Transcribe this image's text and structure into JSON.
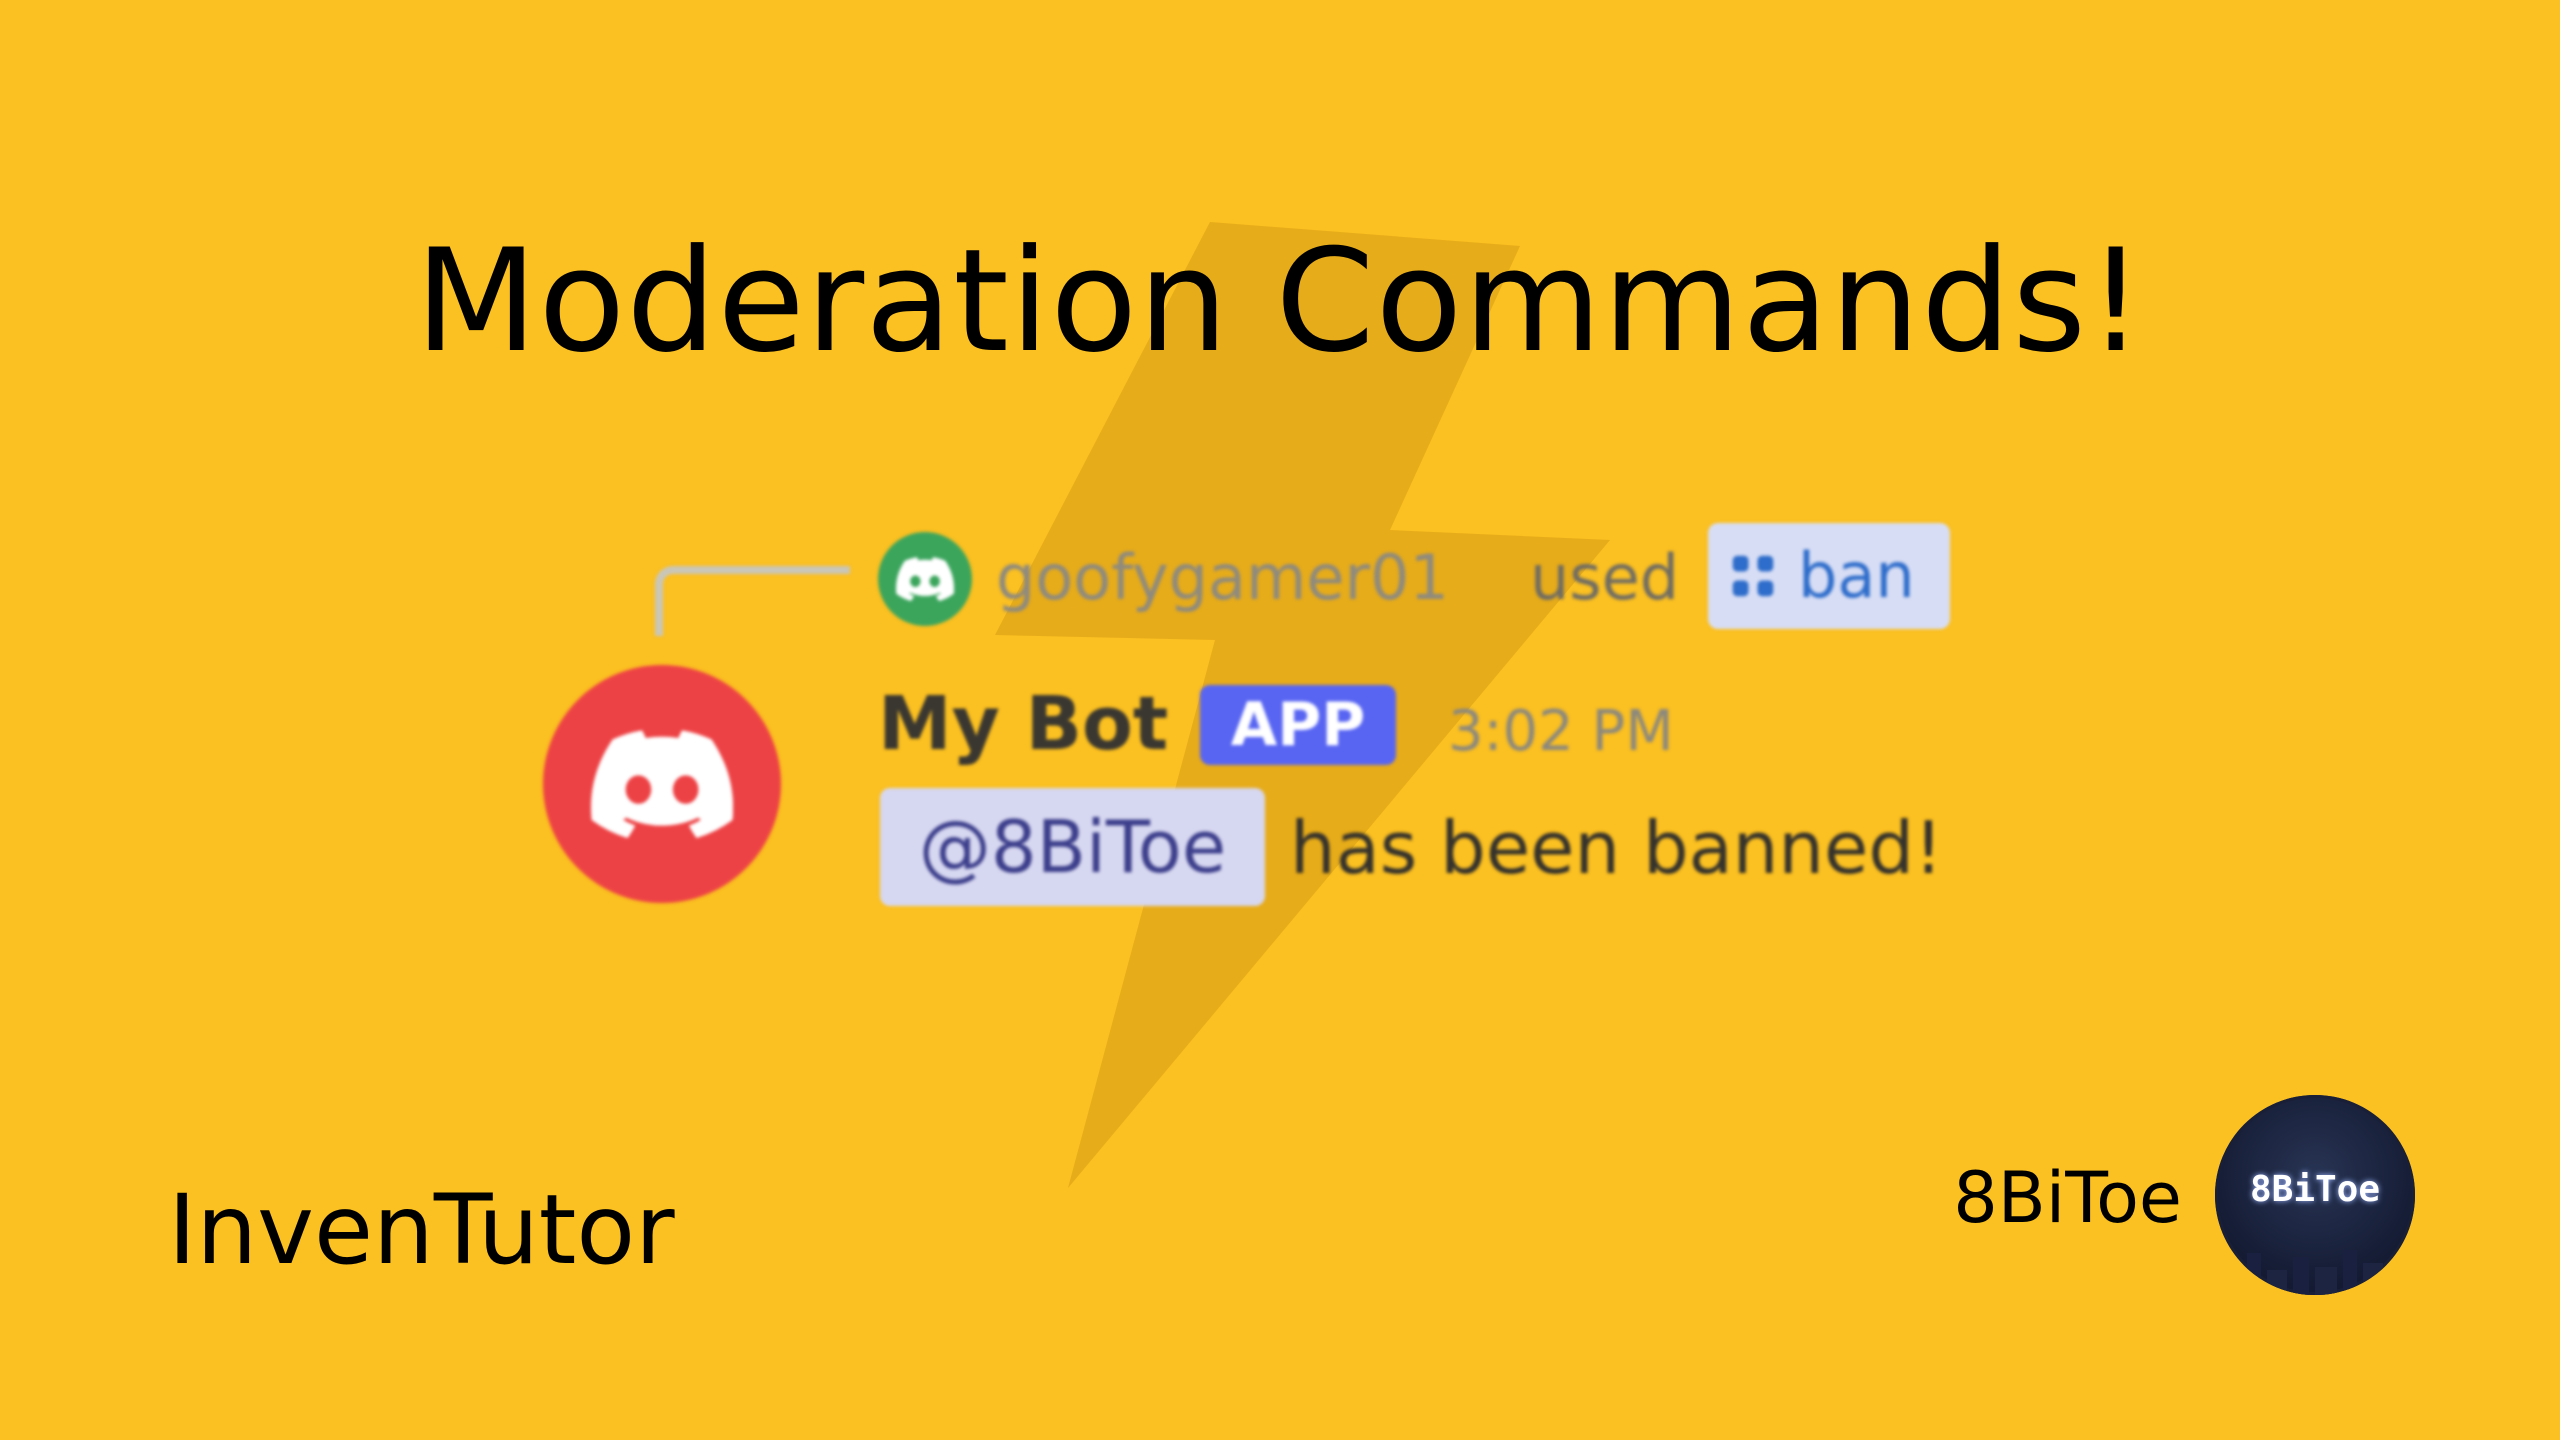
{
  "title": "Moderation Commands!",
  "branding": {
    "left": "InvenTutor",
    "right": "8BiToe",
    "avatar_text": "8BiToe"
  },
  "message": {
    "reply": {
      "username": "goofygamer01",
      "verb": "used",
      "command": "ban"
    },
    "bot_name": "My Bot",
    "badge": "APP",
    "timestamp": "3:02 PM",
    "mention": "@8BiToe",
    "text": "has been banned!"
  },
  "colors": {
    "background": "#FBC021",
    "bolt": "#E3A817",
    "discord_red": "#ED4245",
    "discord_green": "#3BA55C",
    "blurple": "#5865F2",
    "command_blue": "#2E6DCB"
  },
  "icons": {
    "reply_avatar": "discord-logo-icon",
    "bot_avatar": "discord-logo-icon",
    "command": "slash-command-grid-icon",
    "background_graphic": "lightning-bolt-icon"
  }
}
